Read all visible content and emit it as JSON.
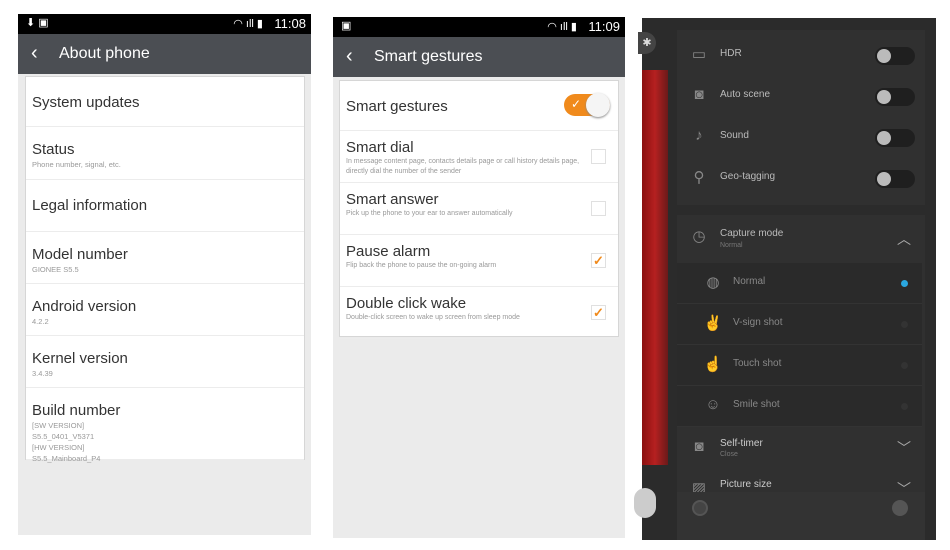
{
  "about": {
    "time": "11:08",
    "title": "About phone",
    "items": [
      {
        "title": "System updates",
        "sub": []
      },
      {
        "title": "Status",
        "sub": [
          "Phone number, signal, etc."
        ]
      },
      {
        "title": "Legal information",
        "sub": []
      },
      {
        "title": "Model number",
        "sub": [
          "GIONEE S5.5"
        ]
      },
      {
        "title": "Android version",
        "sub": [
          "4.2.2"
        ]
      },
      {
        "title": "Kernel version",
        "sub": [
          "3.4.39"
        ]
      },
      {
        "title": "Build number",
        "sub": [
          "[SW VERSION]",
          "S5.5_0401_V5371",
          "[HW VERSION]",
          "S5.5_Mainboard_P4"
        ]
      }
    ]
  },
  "gestures": {
    "time": "11:09",
    "title": "Smart gestures",
    "master": {
      "label": "Smart gestures",
      "on": true
    },
    "items": [
      {
        "title": "Smart dial",
        "sub": "In message content page, contacts details page or call history details page, directly dial the number of the sender",
        "checked": false
      },
      {
        "title": "Smart answer",
        "sub": "Pick up the phone to your ear to answer automatically",
        "checked": false
      },
      {
        "title": "Pause alarm",
        "sub": "Flip back the phone to pause the on-going alarm",
        "checked": true
      },
      {
        "title": "Double click wake",
        "sub": "Double-click screen to wake up screen from sleep mode",
        "checked": true
      }
    ],
    "accent": "#f08a1c"
  },
  "camera": {
    "toggles": [
      {
        "label": "HDR",
        "icon": "hdr-icon"
      },
      {
        "label": "Auto scene",
        "icon": "camera-icon"
      },
      {
        "label": "Sound",
        "icon": "music-note-icon"
      },
      {
        "label": "Geo-tagging",
        "icon": "location-pin-icon"
      }
    ],
    "capture": {
      "label": "Capture mode",
      "value": "Normal"
    },
    "modes": [
      {
        "label": "Normal",
        "selected": true
      },
      {
        "label": "V-sign shot",
        "selected": false
      },
      {
        "label": "Touch shot",
        "selected": false
      },
      {
        "label": "Smile shot",
        "selected": false
      }
    ],
    "timer": {
      "label": "Self-timer",
      "value": "Close"
    },
    "picsize": {
      "label": "Picture size"
    },
    "accent": "#2aa7e0"
  }
}
